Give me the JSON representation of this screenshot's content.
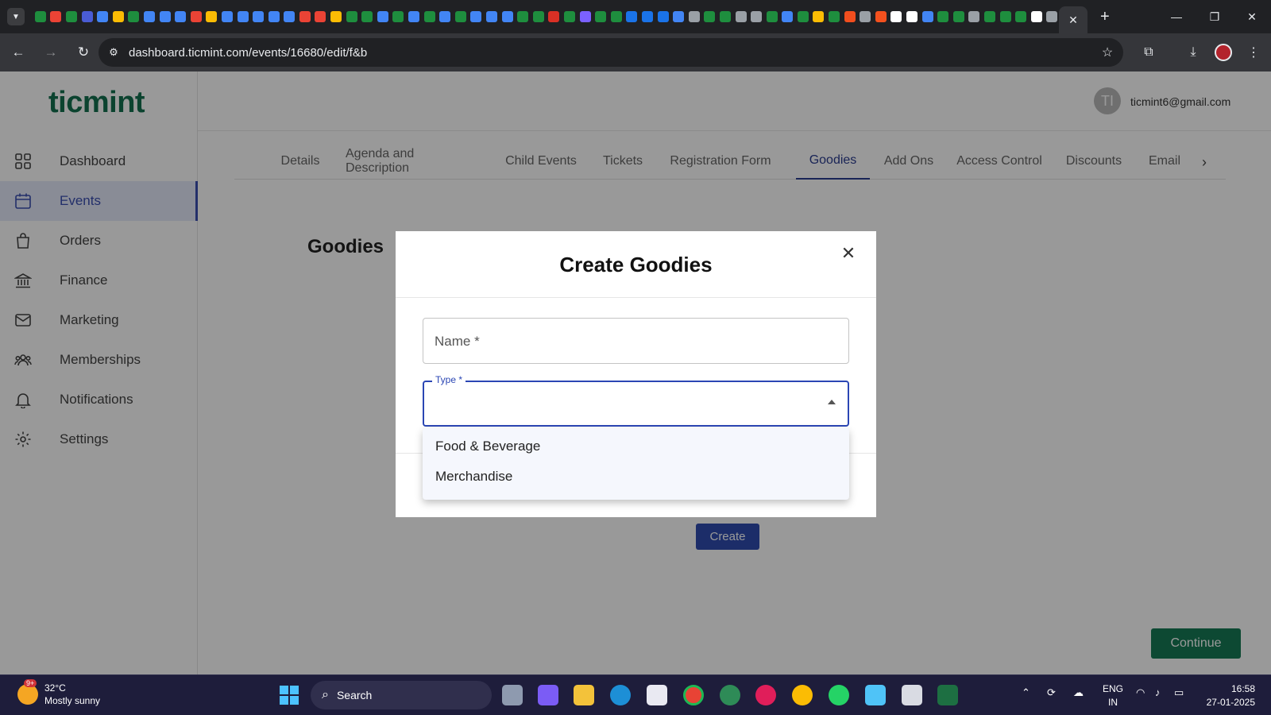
{
  "browser": {
    "url": "dashboard.ticmint.com/events/16680/edit/f&b",
    "new_tab_label": "+",
    "close_tab_label": "✕",
    "tab_favicon_colors": [
      "#1e8e3e",
      "#ea4335",
      "#1e8e3e",
      "#4a5cd4",
      "#4285f4",
      "#fbbc04",
      "#1e8e3e",
      "#4285f4",
      "#4285f4",
      "#4285f4",
      "#ea4335",
      "#fbbc04",
      "#4285f4",
      "#4285f4",
      "#4285f4",
      "#4285f4",
      "#4285f4",
      "#ea4335",
      "#ea4335",
      "#fbbc04",
      "#1e8e3e",
      "#1e8e3e",
      "#4285f4",
      "#1e8e3e",
      "#4285f4",
      "#1e8e3e",
      "#4285f4",
      "#1e8e3e",
      "#4285f4",
      "#4285f4",
      "#4285f4",
      "#1e8e3e",
      "#1e8e3e",
      "#d93025",
      "#1e8e3e",
      "#7b61ff",
      "#1e8e3e",
      "#1e8e3e",
      "#1a73e8",
      "#1a73e8",
      "#1a73e8",
      "#4285f4",
      "#9aa0a6",
      "#1e8e3e",
      "#1e8e3e",
      "#9aa0a6",
      "#9aa0a6",
      "#1e8e3e",
      "#4285f4",
      "#1e8e3e",
      "#fbbc04",
      "#1e8e3e",
      "#f24e1e",
      "#9aa0a6",
      "#f4511e",
      "#ffffff",
      "#ffffff",
      "#4285f4",
      "#1e8e3e",
      "#1e8e3e",
      "#9aa0a6",
      "#1e8e3e",
      "#1e8e3e",
      "#1e8e3e",
      "#ffffff",
      "#9aa0a6"
    ]
  },
  "app": {
    "logo": "ticmint",
    "user": {
      "initials": "TI",
      "email": "ticmint6@gmail.com"
    },
    "sidebar": [
      {
        "label": "Dashboard",
        "icon": "grid-icon"
      },
      {
        "label": "Events",
        "icon": "calendar-icon",
        "active": true
      },
      {
        "label": "Orders",
        "icon": "shopping-bag-icon"
      },
      {
        "label": "Finance",
        "icon": "bank-icon"
      },
      {
        "label": "Marketing",
        "icon": "mail-icon"
      },
      {
        "label": "Memberships",
        "icon": "people-icon"
      },
      {
        "label": "Notifications",
        "icon": "bell-icon"
      },
      {
        "label": "Settings",
        "icon": "gear-icon"
      }
    ],
    "tabs": [
      "Details",
      "Agenda and Description",
      "Child Events",
      "Tickets",
      "Registration Form",
      "Goodies",
      "Add Ons",
      "Access Control",
      "Discounts",
      "Email"
    ],
    "active_tab": "Goodies",
    "page_title": "Goodies",
    "create_button": "Create",
    "continue_button": "Continue",
    "accent_color": "#2b3c8f",
    "brand_color": "#13714f"
  },
  "modal": {
    "title": "Create Goodies",
    "name_placeholder": "Name *",
    "type_label": "Type *",
    "type_value": "",
    "type_options": [
      "Food & Beverage",
      "Merchandise"
    ]
  },
  "taskbar": {
    "weather_temp": "32°C",
    "weather_desc": "Mostly sunny",
    "weather_badge": "9+",
    "search_label": "Search",
    "lang_line1": "ENG",
    "lang_line2": "IN",
    "time": "16:58",
    "date": "27-01-2025"
  }
}
